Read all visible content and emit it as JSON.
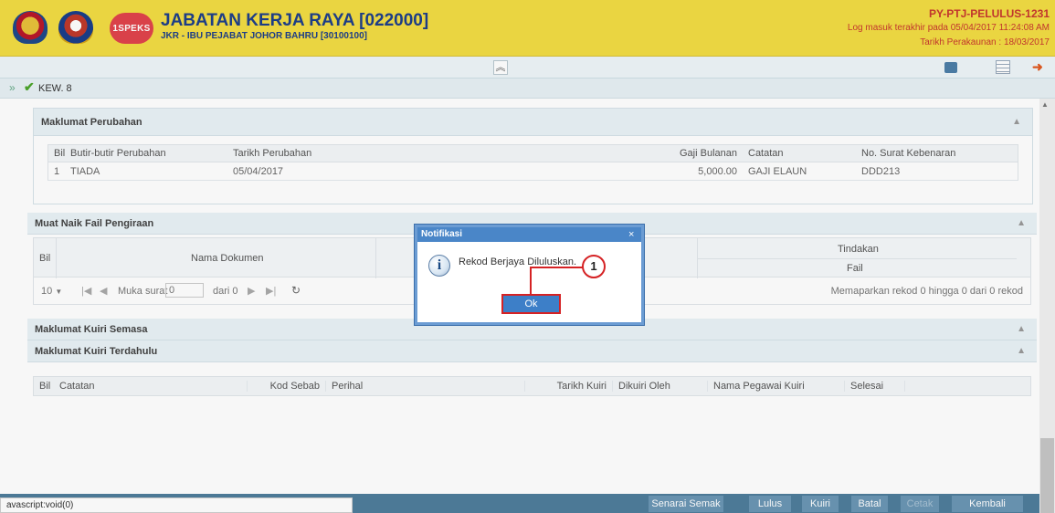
{
  "header": {
    "logo_text": "1SPEKS",
    "title": "JABATAN KERJA RAYA [022000]",
    "subtitle": "JKR - IBU PEJABAT JOHOR BAHRU [30100100]",
    "user_id": "PY-PTJ-PELULUS-1231",
    "last_login": "Log masuk terakhir pada 05/04/2017 11:24:08 AM",
    "account_date": "Tarikh Perakaunan : 18/03/2017"
  },
  "toolbar": {
    "collapse_icon": "double-chevron-up",
    "icons": [
      "print-icon",
      "list-icon",
      "logout-icon"
    ]
  },
  "breadcrumb": {
    "expand": "»",
    "label": "KEW. 8"
  },
  "perubahan": {
    "heading": "Maklumat Perubahan",
    "columns": [
      "Bil",
      "Butir-butir Perubahan",
      "Tarikh Perubahan",
      "Gaji Bulanan",
      "Catatan",
      "No. Surat Kebenaran"
    ],
    "rows": [
      [
        "1",
        "TIADA",
        "05/04/2017",
        "5,000.00",
        "GAJI ELAUN",
        "DDD213"
      ]
    ]
  },
  "muat_naik": {
    "heading": "Muat Naik Fail Pengiraan",
    "col_bil": "Bil",
    "col_nama": "Nama Dokumen",
    "col_tindakan": "Tindakan",
    "col_fail": "Fail",
    "pager": {
      "page_size": "10",
      "page_label": "Muka surat",
      "page_value": "0",
      "of_label": "dari 0",
      "info": "Memaparkan rekod 0 hingga 0 dari 0 rekod"
    }
  },
  "kuiri_semasa": {
    "heading": "Maklumat Kuiri Semasa"
  },
  "kuiri_terdahulu": {
    "heading": "Maklumat Kuiri Terdahulu",
    "columns": [
      "Bil",
      "Catatan",
      "Kod Sebab",
      "Perihal",
      "Tarikh Kuiri",
      "Dikuiri Oleh",
      "Nama Pegawai Kuiri",
      "Selesai"
    ]
  },
  "bottom_buttons": [
    "Senarai Semak",
    "Lulus",
    "Kuiri",
    "Batal",
    "Cetak",
    "Kembali"
  ],
  "status_url": "avascript:void(0)",
  "modal": {
    "title": "Notifikasi",
    "close": "×",
    "message": "Rekod Berjaya Diluluskan.",
    "ok_label": "Ok",
    "callout": "1"
  },
  "colors": {
    "header_bg": "#f2dc44",
    "title": "#1e3f8b",
    "accent_red": "#d52224",
    "button_blue": "#6b96b4"
  }
}
